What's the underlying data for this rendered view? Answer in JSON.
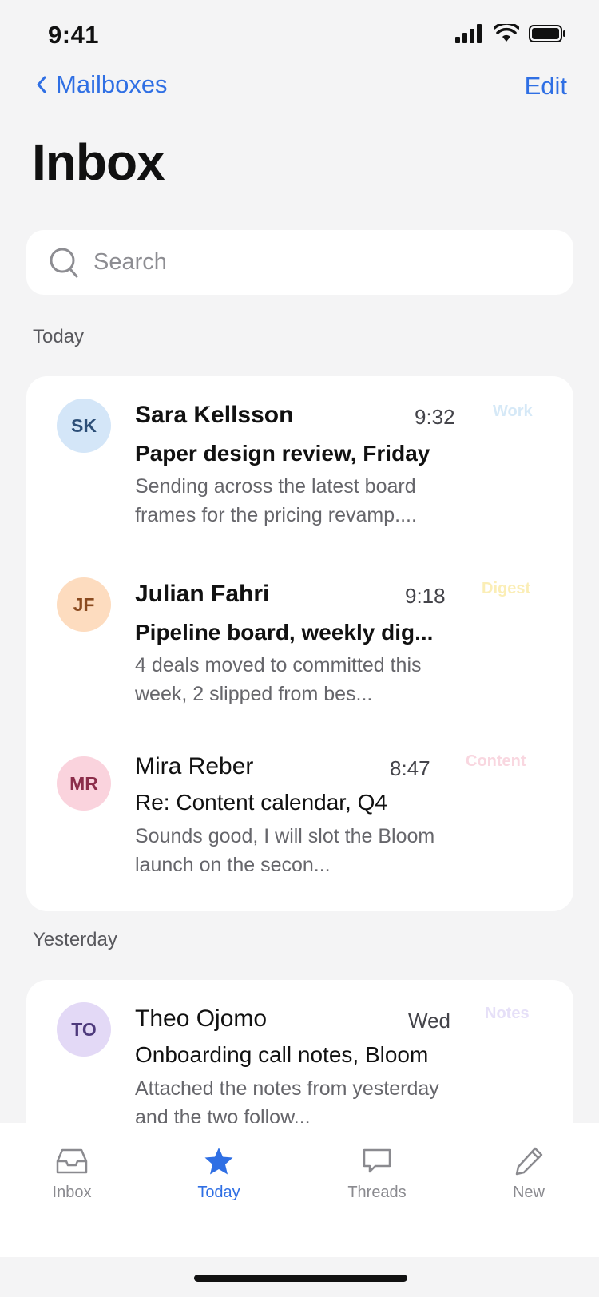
{
  "status": {
    "time": "9:41"
  },
  "nav": {
    "back_label": "Mailboxes",
    "edit_label": "Edit"
  },
  "title": "Inbox",
  "search": {
    "placeholder": "Search",
    "value": ""
  },
  "sections": [
    {
      "label": "Today",
      "emails": [
        {
          "initials": "SK",
          "sender": "Sara Kellsson",
          "time": "9:32",
          "tag": "Work",
          "subject": "Paper design review, Friday",
          "preview": "Sending across the latest board frames for the pricing revamp....",
          "unread": true,
          "avatar_bg": "#d4e6f8",
          "avatar_fg": "#2d4f78",
          "tag_color": "#d6e9f7"
        },
        {
          "initials": "JF",
          "sender": "Julian Fahri",
          "time": "9:18",
          "tag": "Digest",
          "subject": "Pipeline board, weekly dig...",
          "preview": "4 deals moved to committed this week, 2 slipped from bes...",
          "unread": true,
          "avatar_bg": "#fddcbf",
          "avatar_fg": "#8a4a1f",
          "tag_color": "#fbeeb6"
        },
        {
          "initials": "MR",
          "sender": "Mira Reber",
          "time": "8:47",
          "tag": "Content",
          "subject": "Re: Content calendar, Q4",
          "preview": "Sounds good, I will slot the Bloom launch on the secon...",
          "unread": false,
          "avatar_bg": "#fad3dd",
          "avatar_fg": "#8c2d4a",
          "tag_color": "#f9d7e0"
        }
      ]
    },
    {
      "label": "Yesterday",
      "emails": [
        {
          "initials": "TO",
          "sender": "Theo Ojomo",
          "time": "Wed",
          "tag": "Notes",
          "subject": "Onboarding call notes, Bloom",
          "preview": "Attached the notes from yesterday and the two follow...",
          "unread": false,
          "avatar_bg": "#e3d9f6",
          "avatar_fg": "#4e3a7c",
          "tag_color": "#e6e0f8"
        }
      ]
    }
  ],
  "tabs": [
    {
      "label": "Inbox",
      "icon": "inbox-icon",
      "active": false
    },
    {
      "label": "Today",
      "icon": "star-icon",
      "active": true
    },
    {
      "label": "Threads",
      "icon": "chat-bubble-icon",
      "active": false
    },
    {
      "label": "New",
      "icon": "pencil-icon",
      "active": false
    }
  ],
  "colors": {
    "accent": "#2f6fe4",
    "background": "#f4f4f5",
    "inactive_tab": "#8a8a8f"
  }
}
